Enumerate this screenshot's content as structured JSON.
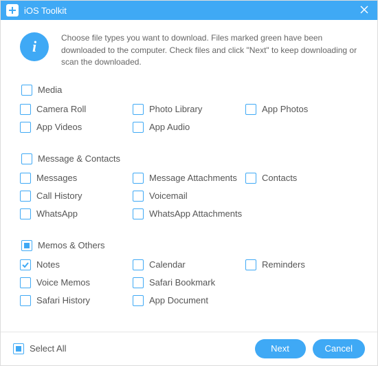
{
  "title": "iOS Toolkit",
  "info_text": "Choose file types you want to download. Files marked green have been downloaded to the computer. Check files and click \"Next\" to keep downloading or scan the downloaded.",
  "groups": {
    "media": {
      "head": {
        "label": "Media",
        "state": "unchecked"
      },
      "items": [
        {
          "label": "Camera Roll",
          "state": "unchecked"
        },
        {
          "label": "App Videos",
          "state": "unchecked"
        },
        {
          "label": "Photo Library",
          "state": "unchecked"
        },
        {
          "label": "App Audio",
          "state": "unchecked"
        },
        {
          "label": "App Photos",
          "state": "unchecked"
        }
      ]
    },
    "messages": {
      "head": {
        "label": "Message & Contacts",
        "state": "unchecked"
      },
      "items": [
        {
          "label": "Messages",
          "state": "unchecked"
        },
        {
          "label": "Call History",
          "state": "unchecked"
        },
        {
          "label": "WhatsApp",
          "state": "unchecked"
        },
        {
          "label": "Message Attachments",
          "state": "unchecked"
        },
        {
          "label": "Voicemail",
          "state": "unchecked"
        },
        {
          "label": "WhatsApp Attachments",
          "state": "unchecked"
        },
        {
          "label": "Contacts",
          "state": "unchecked"
        }
      ]
    },
    "memos": {
      "head": {
        "label": "Memos & Others",
        "state": "indeterminate"
      },
      "items": [
        {
          "label": "Notes",
          "state": "checked"
        },
        {
          "label": "Voice Memos",
          "state": "unchecked"
        },
        {
          "label": "Safari History",
          "state": "unchecked"
        },
        {
          "label": "Calendar",
          "state": "unchecked"
        },
        {
          "label": "Safari Bookmark",
          "state": "unchecked"
        },
        {
          "label": "App Document",
          "state": "unchecked"
        },
        {
          "label": "Reminders",
          "state": "unchecked"
        }
      ]
    }
  },
  "select_all": {
    "label": "Select All",
    "state": "indeterminate"
  },
  "buttons": {
    "next": "Next",
    "cancel": "Cancel"
  }
}
